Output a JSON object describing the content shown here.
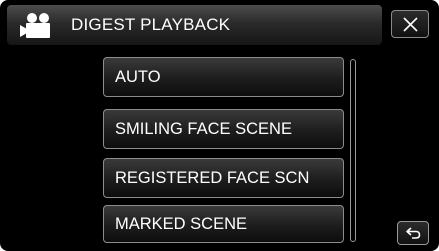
{
  "header": {
    "title": "DIGEST PLAYBACK",
    "mode_icon": "video-camera-icon",
    "close_icon": "close-icon"
  },
  "menu": {
    "items": [
      {
        "label": "AUTO"
      },
      {
        "label": "SMILING FACE SCENE"
      },
      {
        "label": "REGISTERED FACE SCN"
      },
      {
        "label": "MARKED SCENE"
      }
    ]
  },
  "footer": {
    "return_icon": "return-icon"
  },
  "colors": {
    "background": "#000000",
    "text": "#ffffff",
    "button_border": "#8c8c8c"
  }
}
